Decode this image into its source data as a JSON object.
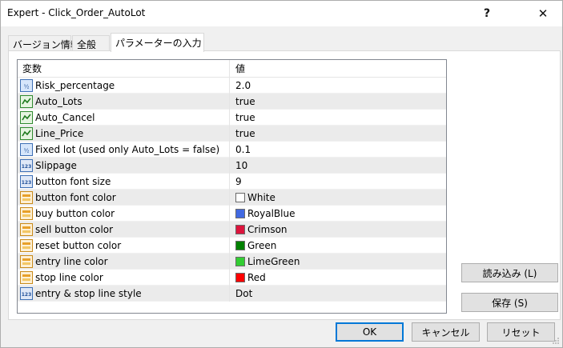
{
  "window": {
    "title": "Expert - Click_Order_AutoLot",
    "help_glyph": "?",
    "close_glyph": "✕"
  },
  "tabs": [
    {
      "label": "バージョン情報"
    },
    {
      "label": "全般"
    },
    {
      "label": "パラメーターの入力"
    }
  ],
  "grid": {
    "header_variable": "変数",
    "header_value": "値",
    "rows": [
      {
        "name": "Risk_percentage",
        "value": "2.0",
        "icon": "double-param-icon"
      },
      {
        "name": "Auto_Lots",
        "value": "true",
        "icon": "bool-param-icon"
      },
      {
        "name": "Auto_Cancel",
        "value": "true",
        "icon": "bool-param-icon"
      },
      {
        "name": "Line_Price",
        "value": "true",
        "icon": "bool-param-icon"
      },
      {
        "name": "Fixed lot (used only Auto_Lots = false)",
        "value": "0.1",
        "icon": "double-param-icon"
      },
      {
        "name": "Slippage",
        "value": "10",
        "icon": "int-param-icon"
      },
      {
        "name": "button font size",
        "value": "9",
        "icon": "int-param-icon"
      },
      {
        "name": "button font color",
        "value": "White",
        "icon": "color-param-icon",
        "color": "#ffffff"
      },
      {
        "name": "buy button color",
        "value": "RoyalBlue",
        "icon": "color-param-icon",
        "color": "#4169e1"
      },
      {
        "name": "sell button color",
        "value": "Crimson",
        "icon": "color-param-icon",
        "color": "#dc143c"
      },
      {
        "name": "reset button color",
        "value": "Green",
        "icon": "color-param-icon",
        "color": "#008000"
      },
      {
        "name": "entry line color",
        "value": "LimeGreen",
        "icon": "color-param-icon",
        "color": "#32cd32"
      },
      {
        "name": "stop line color",
        "value": "Red",
        "icon": "color-param-icon",
        "color": "#ff0000"
      },
      {
        "name": "entry & stop line style",
        "value": "Dot",
        "icon": "int-param-icon"
      }
    ]
  },
  "buttons": {
    "load": "読み込み (L)",
    "save": "保存 (S)",
    "ok": "OK",
    "cancel": "キャンセル",
    "reset": "リセット"
  },
  "colors": {
    "accent": "#0078d7",
    "alt_row": "#ebebeb"
  }
}
